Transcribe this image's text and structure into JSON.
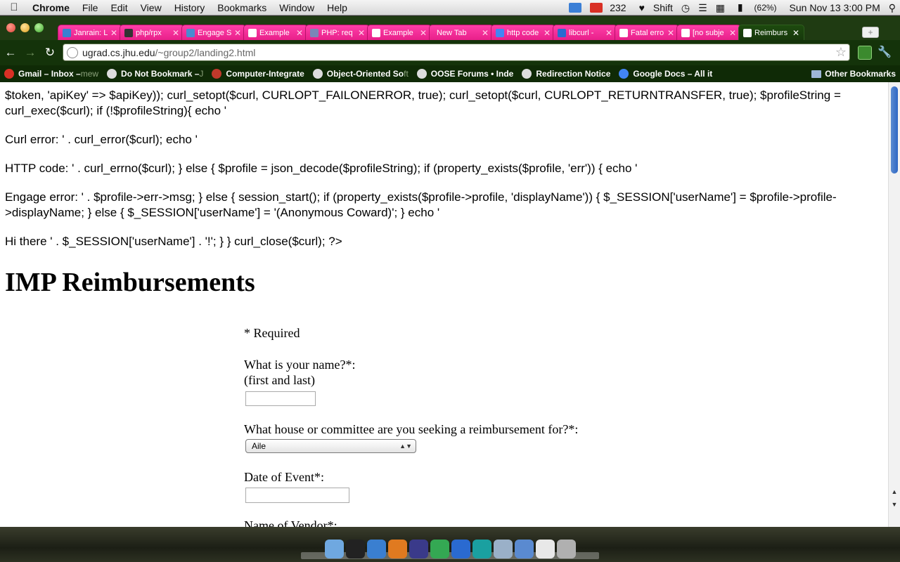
{
  "menubar": {
    "app_name": "Chrome",
    "items": [
      "File",
      "Edit",
      "View",
      "History",
      "Bookmarks",
      "Window",
      "Help"
    ],
    "mail_count": "232",
    "input_mode": "Shift",
    "battery": "(62%)",
    "datetime": "Sun Nov 13  3:00 PM"
  },
  "tabs": [
    {
      "label": "Janrain: L",
      "color": "#3a7fd0"
    },
    {
      "label": "php/rpx",
      "color": "#333333"
    },
    {
      "label": "Engage S",
      "color": "#4a8ad0"
    },
    {
      "label": "Example",
      "color": "#ffffff"
    },
    {
      "label": "PHP: req",
      "color": "#7a86b8"
    },
    {
      "label": "Example",
      "color": "#ffffff"
    },
    {
      "label": "New Tab",
      "color": ""
    },
    {
      "label": "http code",
      "color": "#4285f4"
    },
    {
      "label": "libcurl - ",
      "color": "#2a6ad0"
    },
    {
      "label": "Fatal erro",
      "color": "#ffffff"
    },
    {
      "label": "[no subje",
      "color": "#ffffff"
    },
    {
      "label": "Reimburs",
      "color": "#ffffff"
    }
  ],
  "toolbar": {
    "url_host": "ugrad.cs.jhu.edu",
    "url_path": "/~group2/landing2.html"
  },
  "bookmarks": [
    {
      "label": "Gmail – Inbox – ",
      "fade": "mew",
      "color": "#d93025"
    },
    {
      "label": "Do Not Bookmark – ",
      "fade": "J",
      "color": "#dddddd"
    },
    {
      "label": "Computer-Integrate",
      "fade": "",
      "color": "#c0392b"
    },
    {
      "label": "Object-Oriented So",
      "fade": "ft",
      "color": "#dddddd"
    },
    {
      "label": "OOSE Forums • Inde",
      "fade": "",
      "color": "#dddddd"
    },
    {
      "label": "Redirection Notice",
      "fade": "",
      "color": "#dddddd"
    },
    {
      "label": "Google Docs – All it",
      "fade": "",
      "color": "#4285f4"
    }
  ],
  "bookmarks_other": "Other Bookmarks",
  "page": {
    "code_lines": [
      "$token, 'apiKey' => $apiKey)); curl_setopt($curl, CURLOPT_FAILONERROR, true); curl_setopt($curl, CURLOPT_RETURNTRANSFER, true); $profileString = curl_exec($curl); if (!$profileString){ echo '",
      "Curl error: ' . curl_error($curl); echo '",
      "HTTP code: ' . curl_errno($curl); } else { $profile = json_decode($profileString); if (property_exists($profile, 'err')) { echo '",
      "Engage error: ' . $profile->err->msg; } else { session_start(); if (property_exists($profile->profile, 'displayName')) { $_SESSION['userName'] = $profile->profile->displayName; } else { $_SESSION['userName'] = '(Anonymous Coward)'; } echo '",
      "Hi there ' . $_SESSION['userName'] . '!'; } } curl_close($curl); ?>"
    ],
    "heading": "IMP Reimbursements",
    "required_note": "* Required",
    "form": {
      "name_question": "What is your name?*:",
      "name_hint": "(first and last)",
      "name_value": "",
      "house_question": "What house or committee are you seeking a reimbursement for?*:",
      "house_selected": "Aile",
      "date_question": "Date of Event*:",
      "date_value": "",
      "vendor_question": "Name of Vendor*:"
    }
  },
  "dock_apps": [
    {
      "name": "finder",
      "color": "#6fa8e0"
    },
    {
      "name": "terminal",
      "color": "#222222"
    },
    {
      "name": "itunes",
      "color": "#3a7fd0"
    },
    {
      "name": "matlab",
      "color": "#e07a20"
    },
    {
      "name": "eclipse",
      "color": "#3a3a8a"
    },
    {
      "name": "chrome",
      "color": "#34a853"
    },
    {
      "name": "word",
      "color": "#2a6ad0"
    },
    {
      "name": "arduino",
      "color": "#1aa0a0"
    },
    {
      "name": "preview",
      "color": "#9ab0c8"
    },
    {
      "name": "xcode",
      "color": "#5a8ad0"
    },
    {
      "name": "textedit",
      "color": "#e8e8e8"
    },
    {
      "name": "trash",
      "color": "#b0b0b0"
    }
  ]
}
